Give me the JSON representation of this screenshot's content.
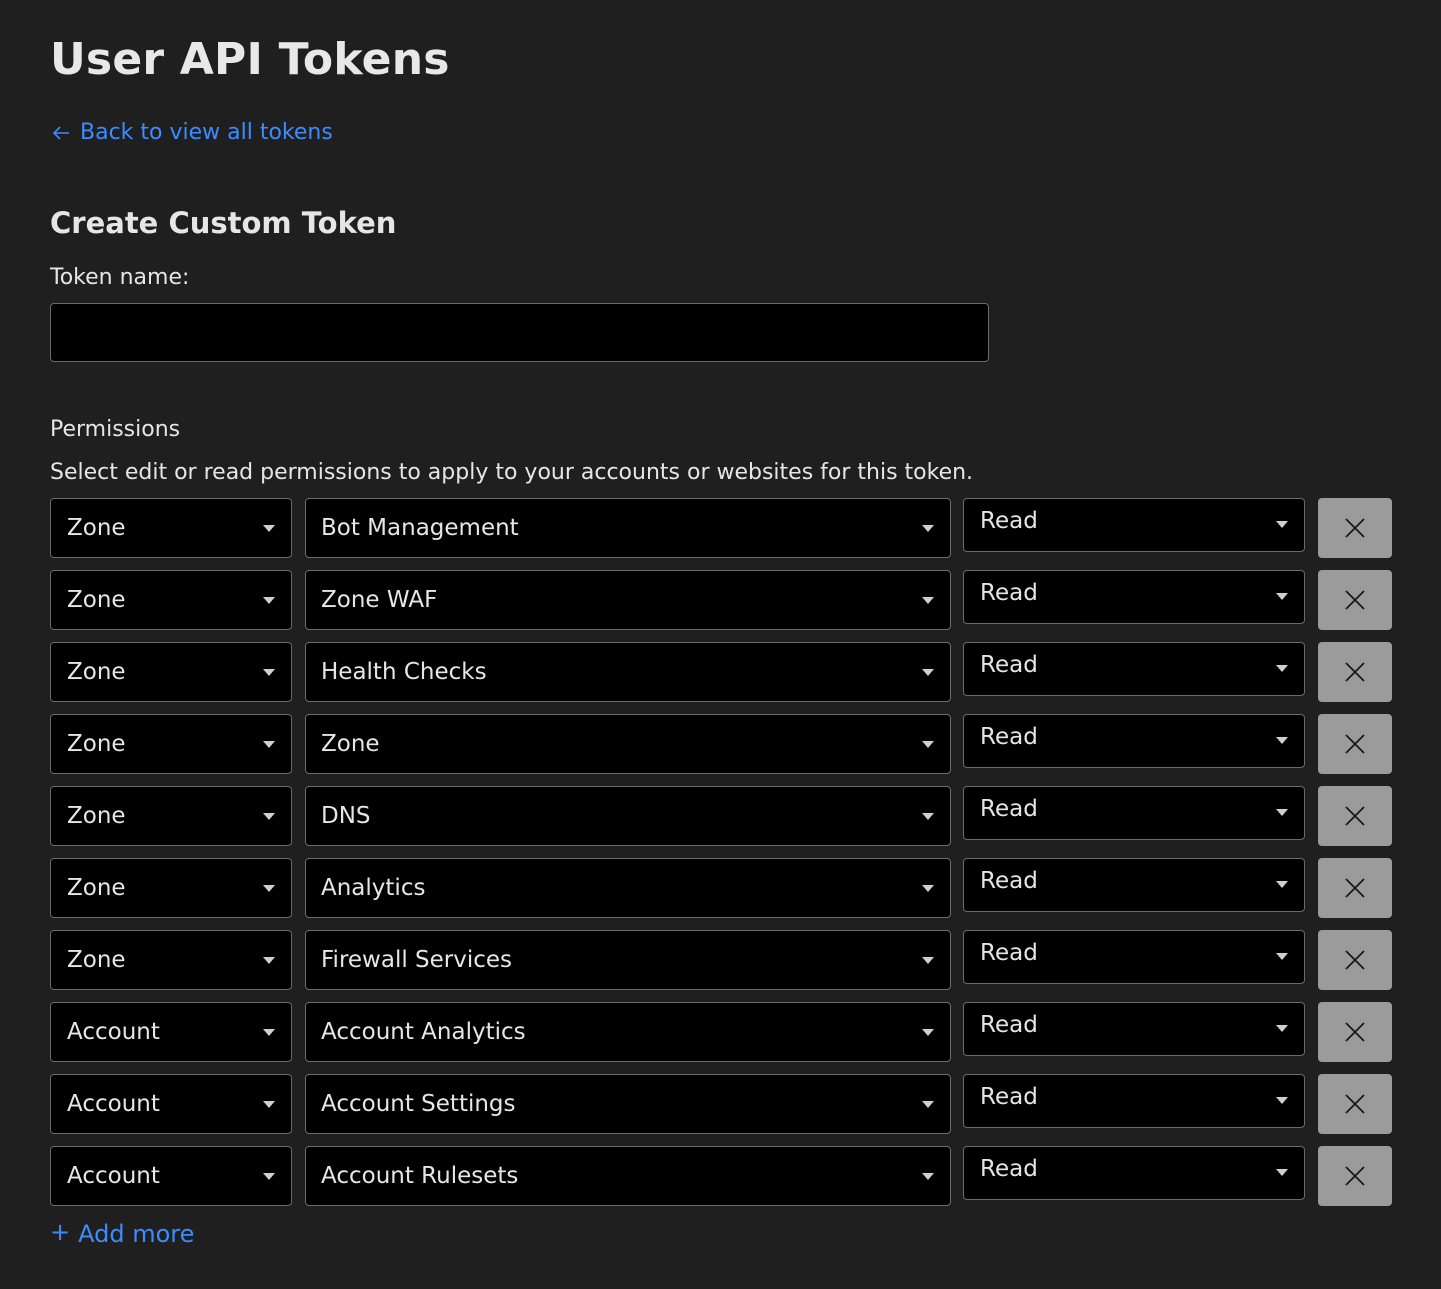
{
  "page": {
    "title": "User API Tokens",
    "back_link": "Back to view all tokens"
  },
  "form": {
    "section_title": "Create Custom Token",
    "token_name_label": "Token name:",
    "token_name_value": "",
    "token_name_placeholder": ""
  },
  "permissions": {
    "title": "Permissions",
    "description": "Select edit or read permissions to apply to your accounts or websites for this token.",
    "rows": [
      {
        "type": "Zone",
        "permission": "Bot Management",
        "level": "Read"
      },
      {
        "type": "Zone",
        "permission": "Zone WAF",
        "level": "Read"
      },
      {
        "type": "Zone",
        "permission": "Health Checks",
        "level": "Read"
      },
      {
        "type": "Zone",
        "permission": "Zone",
        "level": "Read"
      },
      {
        "type": "Zone",
        "permission": "DNS",
        "level": "Read"
      },
      {
        "type": "Zone",
        "permission": "Analytics",
        "level": "Read"
      },
      {
        "type": "Zone",
        "permission": "Firewall Services",
        "level": "Read"
      },
      {
        "type": "Account",
        "permission": "Account Analytics",
        "level": "Read"
      },
      {
        "type": "Account",
        "permission": "Account Settings",
        "level": "Read"
      },
      {
        "type": "Account",
        "permission": "Account Rulesets",
        "level": "Read"
      }
    ],
    "add_more": "Add more"
  },
  "colors": {
    "background": "#1f1f1f",
    "link": "#3b8cff",
    "field": "#000000",
    "remove_button": "#9b9b9b"
  }
}
